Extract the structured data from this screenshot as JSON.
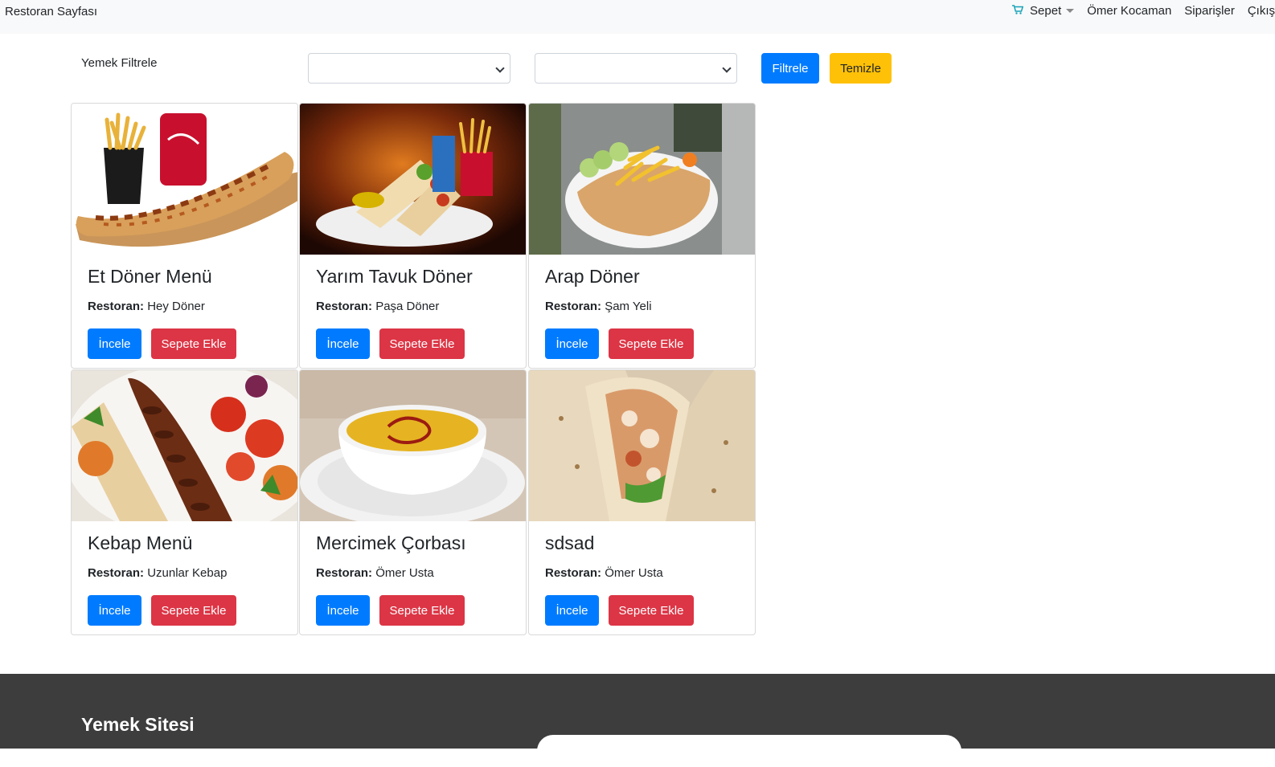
{
  "navbar": {
    "brand": "Restoran Sayfası",
    "cart_label": "Sepet",
    "user_name": "Ömer Kocaman",
    "orders_label": "Siparişler",
    "logout_label": "Çıkış"
  },
  "filter": {
    "label": "Yemek Filtrele",
    "select1_value": "",
    "select2_value": "",
    "filter_button": "Filtrele",
    "clear_button": "Temizle"
  },
  "colors": {
    "primary": "#007bff",
    "danger": "#dc3545",
    "warning": "#ffc107",
    "footer": "#3d3d3d"
  },
  "cards": [
    {
      "title": "Et Döner Menü",
      "restaurant_label": "Restoran:",
      "restaurant": "Hey Döner",
      "view_label": "İncele",
      "add_label": "Sepete Ekle"
    },
    {
      "title": "Yarım Tavuk Döner",
      "restaurant_label": "Restoran:",
      "restaurant": "Paşa Döner",
      "view_label": "İncele",
      "add_label": "Sepete Ekle"
    },
    {
      "title": "Arap Döner",
      "restaurant_label": "Restoran:",
      "restaurant": "Şam Yeli",
      "view_label": "İncele",
      "add_label": "Sepete Ekle"
    },
    {
      "title": "Kebap Menü",
      "restaurant_label": "Restoran:",
      "restaurant": "Uzunlar Kebap",
      "view_label": "İncele",
      "add_label": "Sepete Ekle"
    },
    {
      "title": "Mercimek Çorbası",
      "restaurant_label": "Restoran:",
      "restaurant": "Ömer Usta",
      "view_label": "İncele",
      "add_label": "Sepete Ekle"
    },
    {
      "title": "sdsad",
      "restaurant_label": "Restoran:",
      "restaurant": "Ömer Usta",
      "view_label": "İncele",
      "add_label": "Sepete Ekle"
    }
  ],
  "footer": {
    "title": "Yemek Sitesi"
  }
}
